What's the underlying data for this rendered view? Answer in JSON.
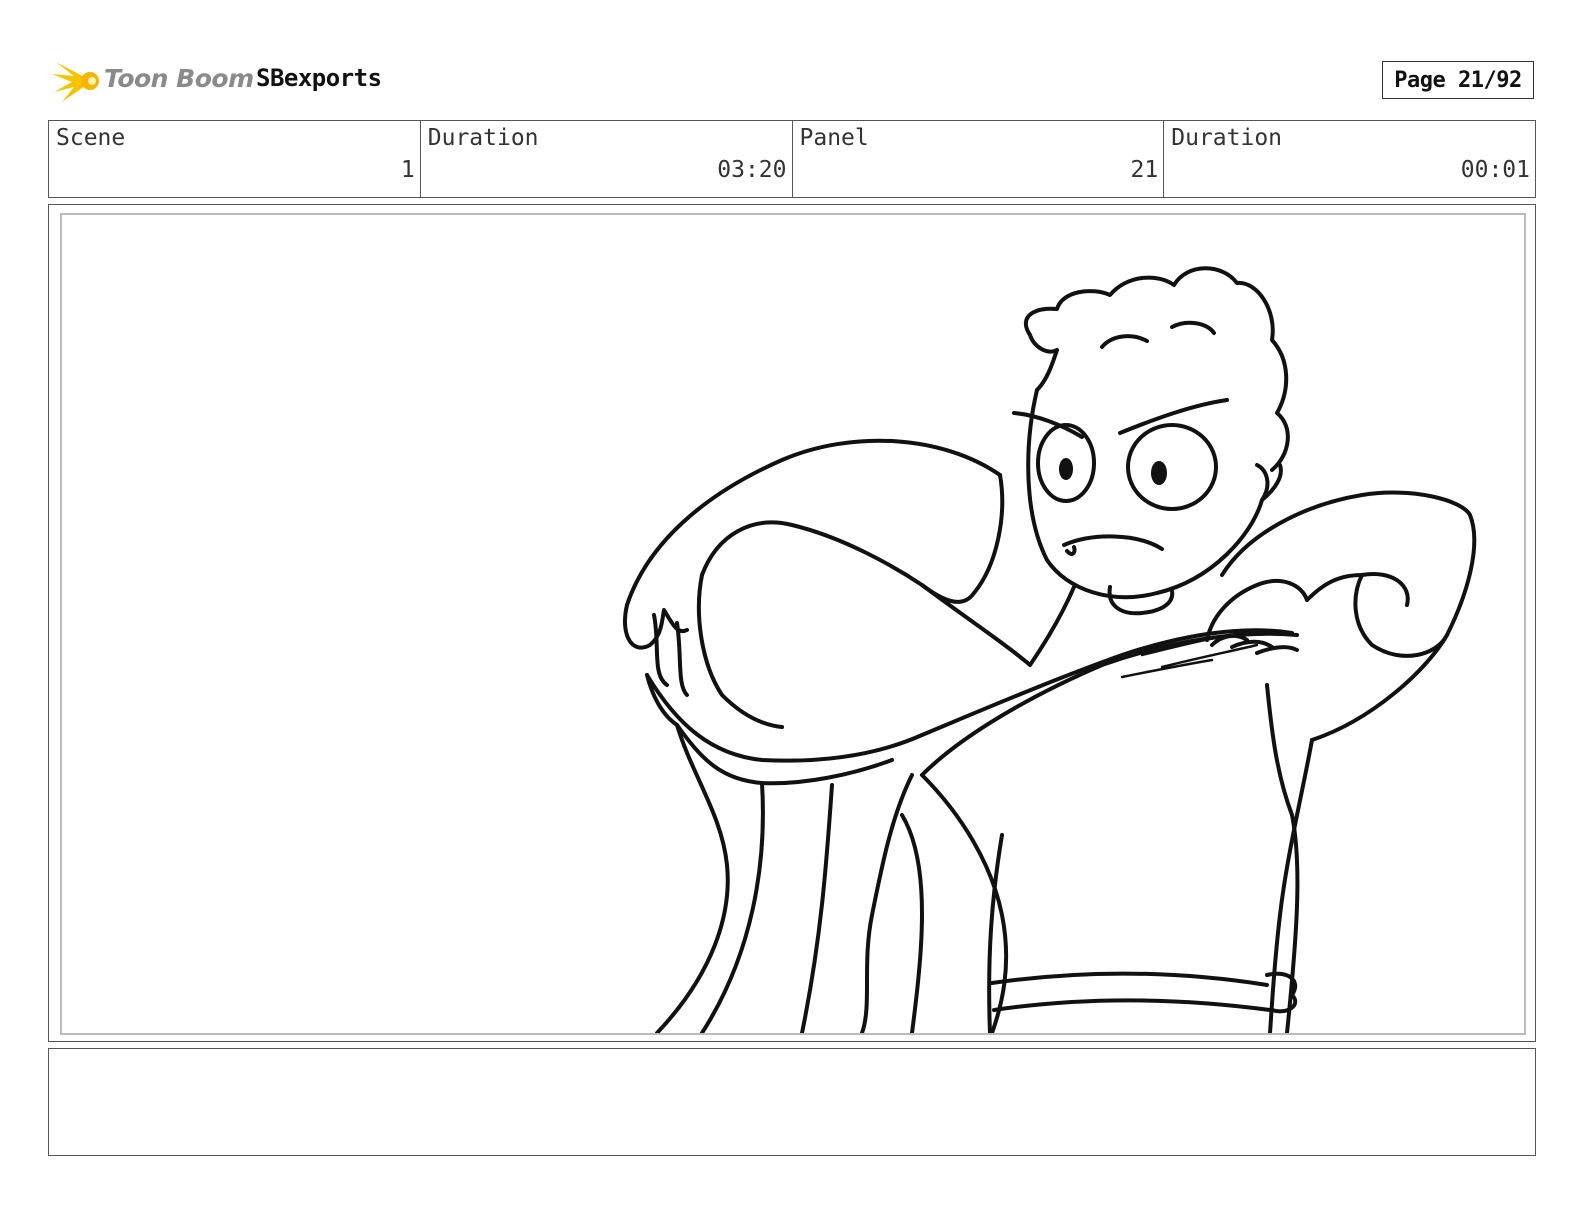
{
  "header": {
    "logo_text": "Toon Boom",
    "project_name": "SBexports",
    "page_label": "Page 21/92"
  },
  "info": {
    "scene_label": "Scene",
    "scene_value": "1",
    "scene_duration_label": "Duration",
    "scene_duration_value": "03:20",
    "panel_label": "Panel",
    "panel_value": "21",
    "panel_duration_label": "Duration",
    "panel_duration_value": "00:01"
  },
  "colors": {
    "logo_accent": "#f5c400",
    "logo_text": "#8a8a8a",
    "sketch_line": "#111111"
  },
  "notes": {
    "text": ""
  }
}
